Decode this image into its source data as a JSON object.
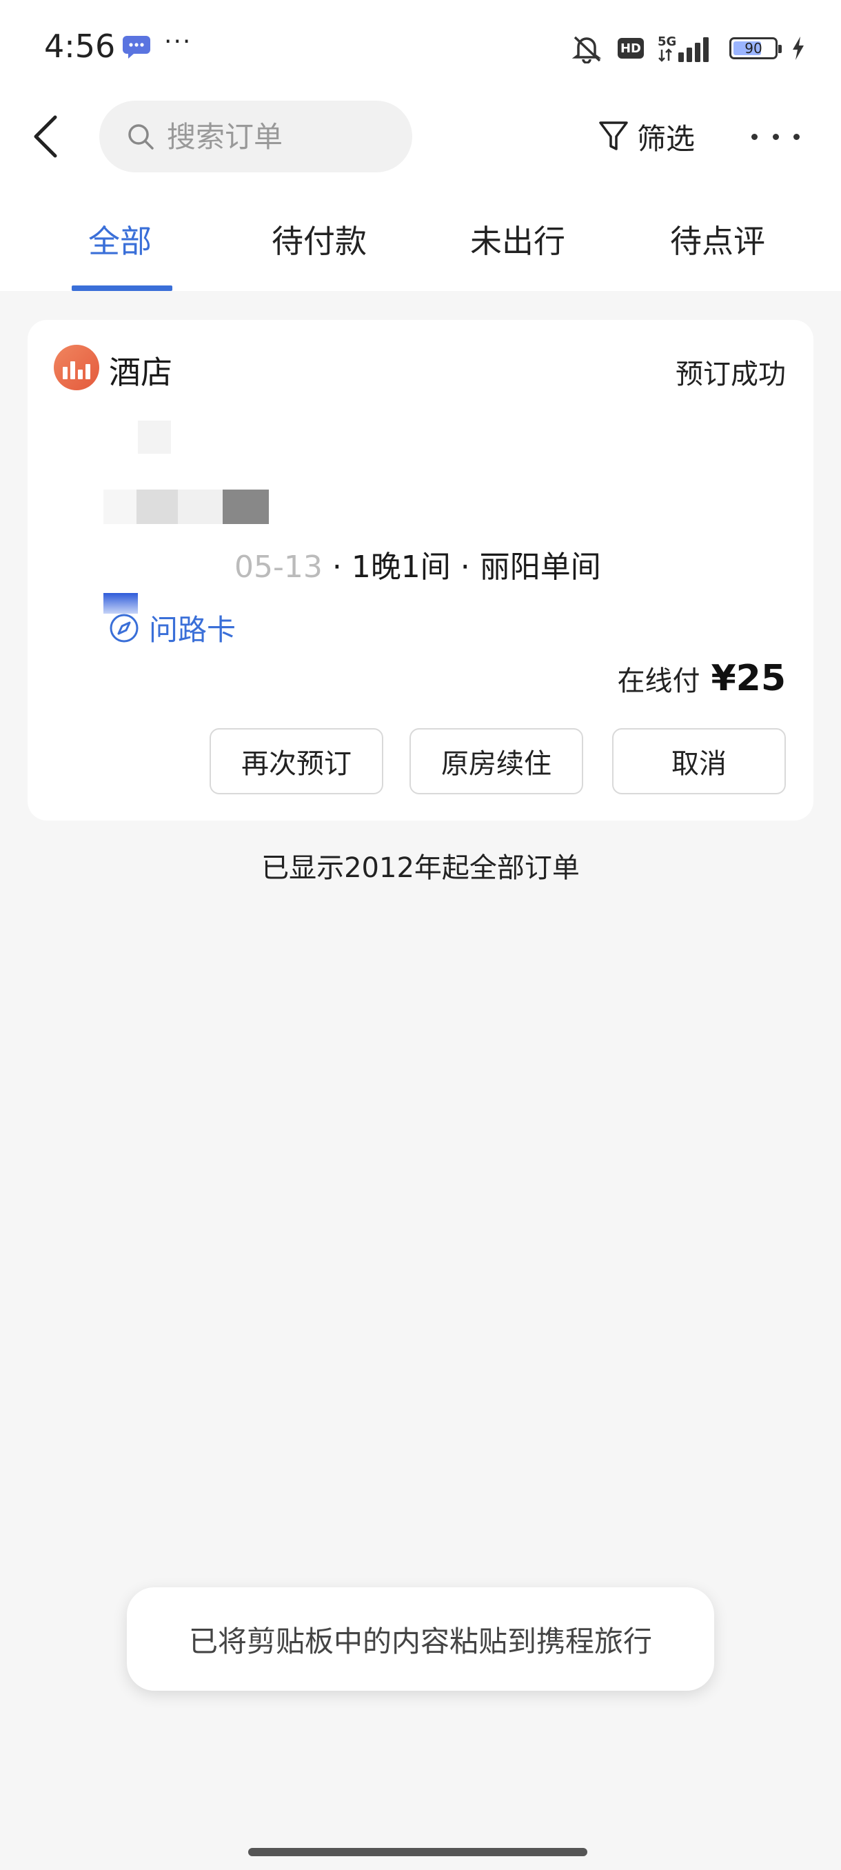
{
  "status_bar": {
    "time": "4:56",
    "dots": "···",
    "network": "5G",
    "hd": "HD",
    "battery": "90",
    "icons": [
      "message-icon",
      "mute-icon",
      "hd-icon",
      "signal-icon",
      "battery-icon",
      "charging-icon"
    ]
  },
  "header": {
    "search_placeholder": "搜索订单",
    "filter_label": "筛选"
  },
  "tabs": [
    {
      "label": "全部",
      "active": true
    },
    {
      "label": "待付款",
      "active": false
    },
    {
      "label": "未出行",
      "active": false
    },
    {
      "label": "待点评",
      "active": false
    }
  ],
  "order": {
    "type": "酒店",
    "status": "预订成功",
    "detail_prefix": "05-13",
    "detail": " · 1晚1间 · 丽阳单间",
    "map_link": "问路卡",
    "price_label": "在线付",
    "price": "¥25",
    "actions": [
      "再次预订",
      "原房续住",
      "取消"
    ]
  },
  "footer_note": "已显示2012年起全部订单",
  "toast": "已将剪贴板中的内容粘贴到携程旅行",
  "colors": {
    "accent": "#3a6fd8",
    "hotel_icon": "#e8674a",
    "background": "#f6f6f6"
  }
}
